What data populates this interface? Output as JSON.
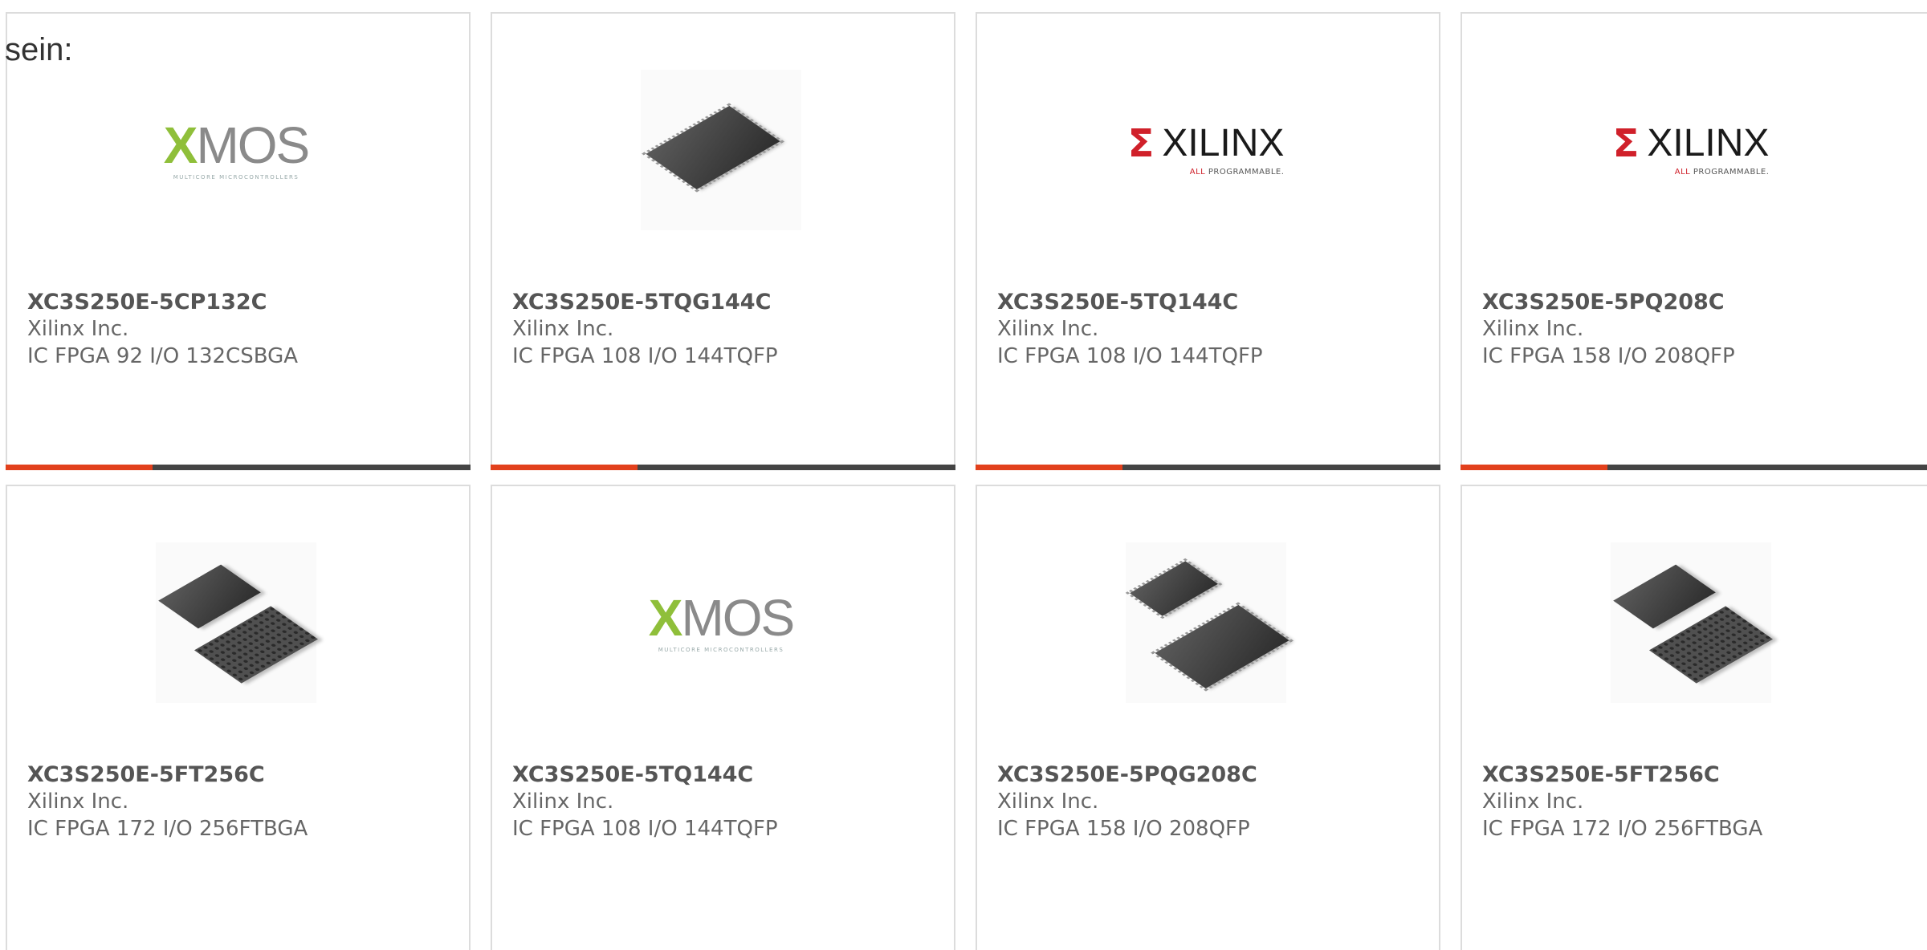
{
  "intro_text": "sein:",
  "cards": [
    {
      "part_number": "XC3S250E-5CP132C",
      "manufacturer": "Xilinx Inc.",
      "description": "IC FPGA 92 I/O 132CSBGA",
      "image": "xmos-logo"
    },
    {
      "part_number": "XC3S250E-5TQG144C",
      "manufacturer": "Xilinx Inc.",
      "description": "IC FPGA 108 I/O 144TQFP",
      "image": "tqfp-chip"
    },
    {
      "part_number": "XC3S250E-5TQ144C",
      "manufacturer": "Xilinx Inc.",
      "description": "IC FPGA 108 I/O 144TQFP",
      "image": "xilinx-logo"
    },
    {
      "part_number": "XC3S250E-5PQ208C",
      "manufacturer": "Xilinx Inc.",
      "description": "IC FPGA 158 I/O 208QFP",
      "image": "xilinx-logo"
    },
    {
      "part_number": "XC3S250E-5FT256C",
      "manufacturer": "Xilinx Inc.",
      "description": "IC FPGA 172 I/O 256FTBGA",
      "image": "bga-chips"
    },
    {
      "part_number": "XC3S250E-5TQ144C",
      "manufacturer": "Xilinx Inc.",
      "description": "IC FPGA 108 I/O 144TQFP",
      "image": "xmos-logo"
    },
    {
      "part_number": "XC3S250E-5PQG208C",
      "manufacturer": "Xilinx Inc.",
      "description": "IC FPGA 158 I/O 208QFP",
      "image": "qfp-chips"
    },
    {
      "part_number": "XC3S250E-5FT256C",
      "manufacturer": "Xilinx Inc.",
      "description": "IC FPGA 172 I/O 256FTBGA",
      "image": "bga-chips"
    }
  ],
  "logos": {
    "xmos": {
      "wordmark": "MOS",
      "initial": "X",
      "tagline": "MULTICORE MICROCONTROLLERS"
    },
    "xilinx": {
      "wordmark": "XILINX",
      "tagline_accent": "ALL",
      "tagline": "PROGRAMMABLE."
    }
  },
  "colors": {
    "accent": "#e2401c",
    "bar": "#444444",
    "text_bold": "#555555",
    "text": "#666666",
    "border": "#dcdcdc"
  }
}
